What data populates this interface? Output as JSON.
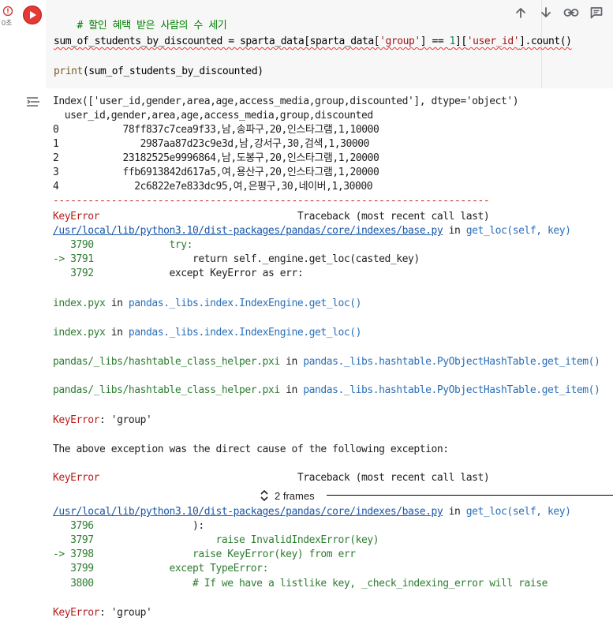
{
  "gutter": {
    "exec_time": "0초"
  },
  "code": {
    "comment": "# 할인 혜택 받은 사람의 수 세기",
    "line2": {
      "a": "sum_of_students_by_discounted = sparta_data[sparta_data[",
      "s1": "'group'",
      "b": "] == ",
      "n1": "1",
      "c": "][",
      "s2": "'user_id'",
      "d": "].count()"
    },
    "line3": {
      "fn": "print",
      "rest": "(sum_of_students_by_discounted)"
    }
  },
  "toolbar": {
    "icons": [
      "arrow-up-icon",
      "arrow-down-icon",
      "link-icon",
      "comment-icon"
    ]
  },
  "output": {
    "index_line": "Index(['user_id,gender,area,age,access_media,group,discounted'], dtype='object')",
    "df_header": "  user_id,gender,area,age,access_media,group,discounted",
    "rows": [
      "0           78ff837c7cea9f33,남,송파구,20,인스타그램,1,10000",
      "1              2987aa87d23c9e3d,남,강서구,30,검색,1,30000",
      "2           23182525e9996864,남,도봉구,20,인스타그램,1,20000",
      "3           ffb6913842d617a5,여,용산구,20,인스타그램,1,20000",
      "4             2c6822e7e833dc95,여,은평구,30,네이버,1,30000"
    ],
    "dashes": "---------------------------------------------------------------------------",
    "tb1": {
      "err": "KeyError",
      "header": "                                  Traceback (most recent call last)",
      "path": "/usr/local/lib/python3.10/dist-packages/pandas/core/indexes/base.py",
      "in": " in ",
      "fn": "get_loc",
      "args": "(self, key)",
      "l1_no": "   3790",
      "l1_code": "             try:",
      "l2_no": "-> 3791",
      "l2_code": "                 return self._engine.get_loc(casted_key)",
      "l3_no": "   3792",
      "l3_code": "             except KeyError as err:"
    },
    "frames_mid": [
      {
        "file": "index.pyx",
        "in": " in ",
        "fn": "pandas._libs.index.IndexEngine.get_loc()"
      },
      {
        "file": "index.pyx",
        "in": " in ",
        "fn": "pandas._libs.index.IndexEngine.get_loc()"
      },
      {
        "file": "pandas/_libs/hashtable_class_helper.pxi",
        "in": " in ",
        "fn": "pandas._libs.hashtable.PyObjectHashTable.get_item()"
      },
      {
        "file": "pandas/_libs/hashtable_class_helper.pxi",
        "in": " in ",
        "fn": "pandas._libs.hashtable.PyObjectHashTable.get_item()"
      }
    ],
    "keyerror_msg1_a": "KeyError",
    "keyerror_msg1_b": ": 'group'",
    "direct_cause": "The above exception was the direct cause of the following exception:",
    "tb2": {
      "err": "KeyError",
      "header": "                                  Traceback (most recent call last)",
      "frames_label": "2 frames",
      "path": "/usr/local/lib/python3.10/dist-packages/pandas/core/indexes/base.py",
      "in": " in ",
      "fn": "get_loc",
      "args": "(self, key)",
      "l1_no": "   3796",
      "l1_code": "                 ):",
      "l2_no": "   3797",
      "l2_code": "                     raise InvalidIndexError(key)",
      "l3_no": "-> 3798",
      "l3_code": "                 raise KeyError(key) from err",
      "l4_no": "   3799",
      "l4_code": "             except TypeError:",
      "l5_no": "   3800",
      "l5_code": "                 # If we have a listlike key, _check_indexing_error will raise"
    },
    "keyerror_msg2_a": "KeyError",
    "keyerror_msg2_b": ": 'group'"
  }
}
